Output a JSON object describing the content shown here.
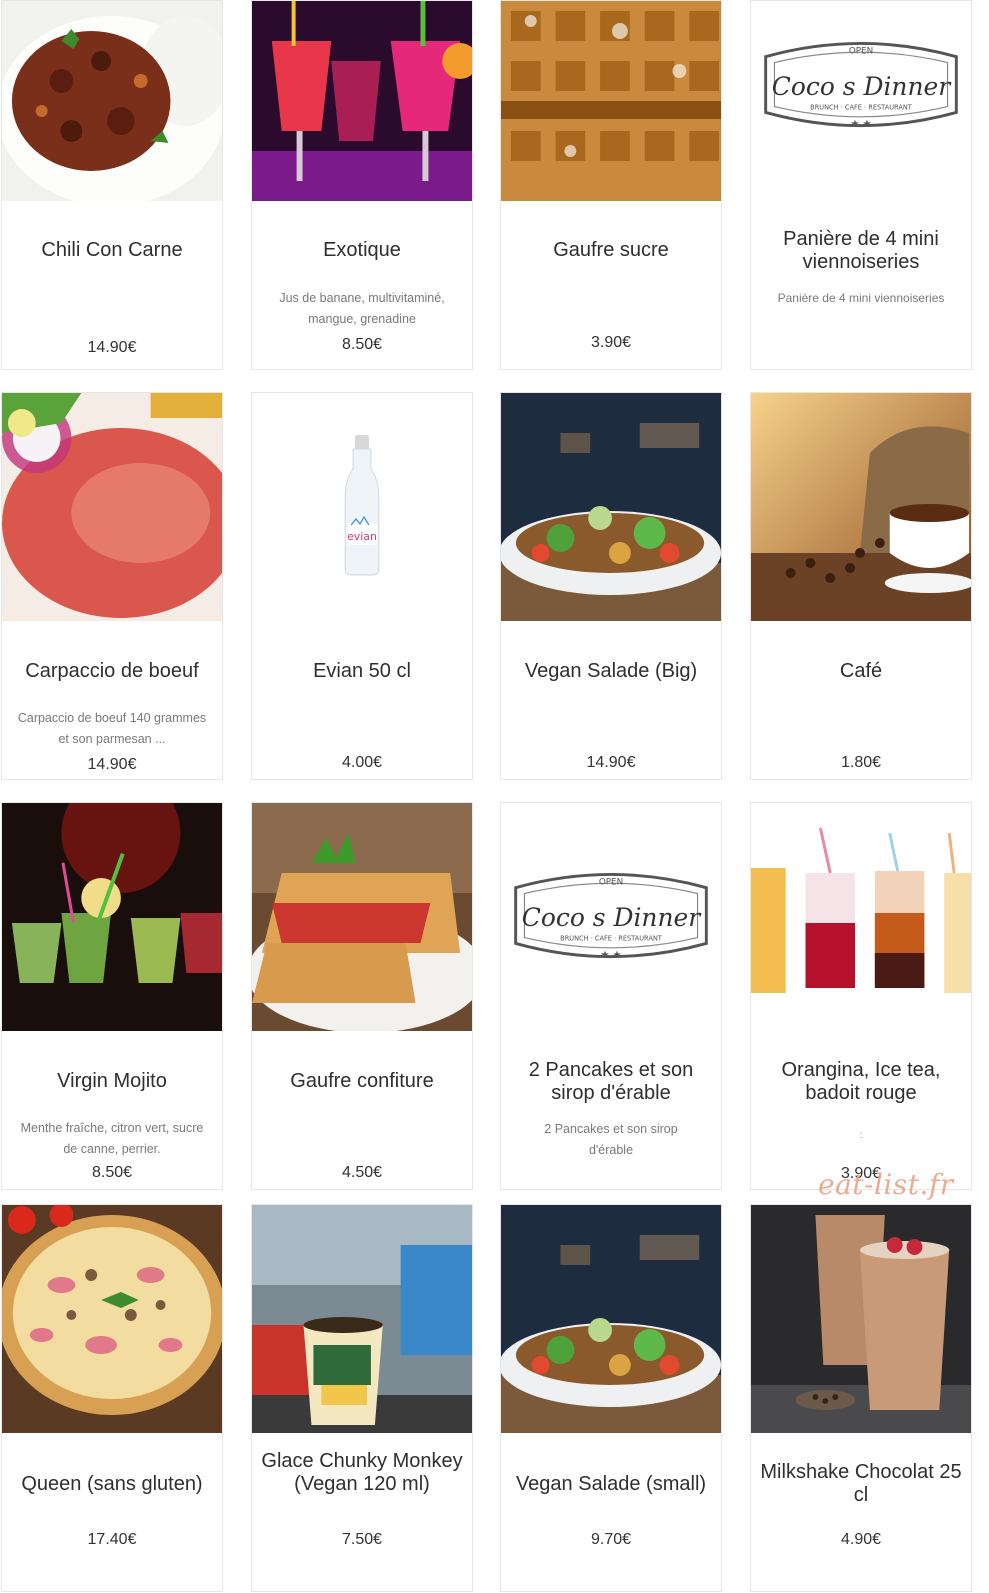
{
  "menu": {
    "items": [
      {
        "name": "Chili Con Carne",
        "description": "",
        "price": "14.90€",
        "image": "chili-con-carne-photo"
      },
      {
        "name": "Exotique",
        "description": "Jus de banane, multivitaminé, mangue, grenadine",
        "price": "8.50€",
        "image": "cocktail-photo"
      },
      {
        "name": "Gaufre sucre",
        "description": "",
        "price": "3.90€",
        "image": "waffle-photo"
      },
      {
        "name": "Panière de 4 mini viennoiseries",
        "description": "Panière de 4 mini viennoiseries",
        "price": "",
        "image": "cocos-dinner-logo"
      },
      {
        "name": "Carpaccio de boeuf",
        "description": "Carpaccio de boeuf 140 grammes et son parmesan ...",
        "price": "14.90€",
        "image": "carpaccio-photo"
      },
      {
        "name": "Evian 50 cl",
        "description": "",
        "price": "4.00€",
        "image": "evian-bottle-photo"
      },
      {
        "name": "Vegan Salade (Big)",
        "description": "",
        "price": "14.90€",
        "image": "salad-photo"
      },
      {
        "name": "Café",
        "description": "",
        "price": "1.80€",
        "image": "coffee-photo"
      },
      {
        "name": "Virgin Mojito",
        "description": "Menthe fraîche, citron vert, sucre de canne, perrier.",
        "price": "8.50€",
        "image": "mojito-photo"
      },
      {
        "name": "Gaufre confiture",
        "description": "",
        "price": "4.50€",
        "image": "jam-waffle-photo"
      },
      {
        "name": "2 Pancakes et son sirop d'érable",
        "description": "2 Pancakes et son sirop d'érable",
        "price": "",
        "image": "cocos-dinner-logo"
      },
      {
        "name": "Orangina, Ice tea, badoit rouge",
        "description": ":",
        "price": "3.90€",
        "image": "soft-drinks-photo"
      },
      {
        "name": "Queen (sans gluten)",
        "description": "",
        "price": "17.40€",
        "image": "pizza-photo"
      },
      {
        "name": "Glace Chunky Monkey (Vegan 120 ml)",
        "description": "",
        "price": "7.50€",
        "image": "ice-cream-tub-photo"
      },
      {
        "name": "Vegan Salade (small)",
        "description": "",
        "price": "9.70€",
        "image": "salad-photo"
      },
      {
        "name": "Milkshake Chocolat 25 cl",
        "description": "",
        "price": "4.90€",
        "image": "milkshake-photo"
      }
    ]
  },
  "logo": {
    "top": "OPEN",
    "top2": "7 DAYS",
    "brand": "Coco s Dinner",
    "sub": "BRUNCH · CAFE · RESTAURANT"
  },
  "watermark": "eat-list.fr"
}
